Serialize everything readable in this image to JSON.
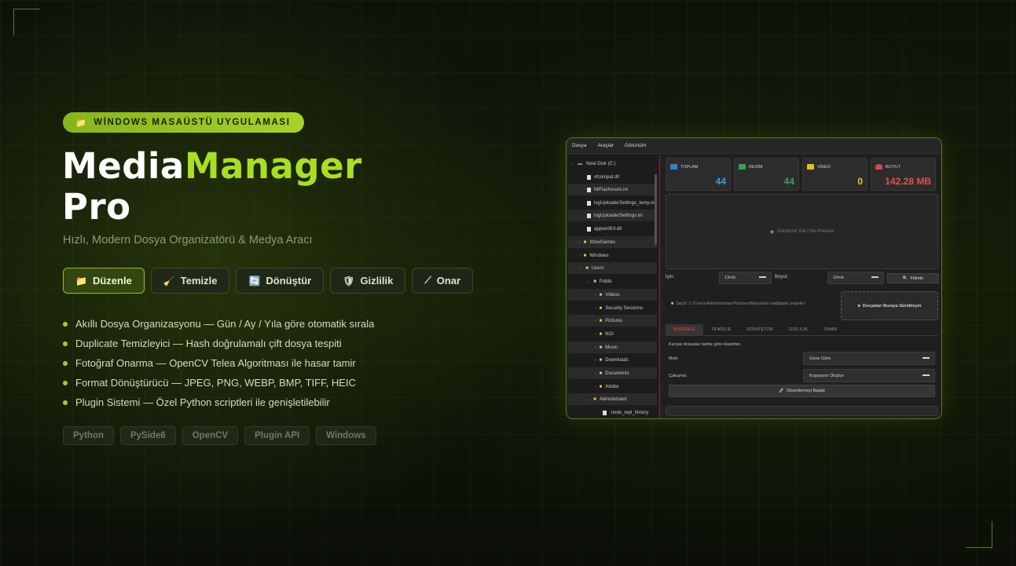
{
  "badge": {
    "icon": "📁",
    "label": "WİNDOWS MASAÜSTÜ UYGULAMASI"
  },
  "hero": {
    "title_part1": "Media",
    "title_part2": "Manager",
    "title_part3": "Pro",
    "subtitle": "Hızlı, Modern Dosya Organizatörü & Medya Aracı"
  },
  "tabs": [
    {
      "icon": "📁",
      "label": "Düzenle",
      "active": true
    },
    {
      "icon": "🧹",
      "label": "Temizle"
    },
    {
      "icon": "🔄",
      "label": "Dönüştür"
    },
    {
      "icon": "🛡",
      "label": "Gizlilik"
    },
    {
      "icon": "⟋",
      "label": "Onar"
    }
  ],
  "features": [
    "Akıllı Dosya Organizasyonu — Gün / Ay / Yıla göre otomatik sırala",
    "Duplicate Temizleyici — Hash doğrulamalı çift dosya tespiti",
    "Fotoğraf Onarma — OpenCV Telea Algoritması ile hasar tamir",
    "Format Dönüştürücü — JPEG, PNG, WEBP, BMP, TIFF, HEIC",
    "Plugin Sistemi — Özel Python scriptleri ile genişletilebilir"
  ],
  "tech": [
    "Python",
    "PySide6",
    "OpenCV",
    "Plugin API",
    "Windows"
  ],
  "app": {
    "menu": [
      "Dosya",
      "Araçlar",
      "Görünüm"
    ],
    "tree": [
      {
        "label": "Yerel Disk (C:)",
        "type": "drive"
      },
      {
        "label": "vfcompat.dll",
        "type": "file"
      },
      {
        "label": "MiFlashvcom.ini",
        "type": "file"
      },
      {
        "label": "logUploaderSettings_temp.ini",
        "type": "file"
      },
      {
        "label": "logUploaderSettings.ini",
        "type": "file"
      },
      {
        "label": "appverifUI.dll",
        "type": "file"
      },
      {
        "label": "XboxGames",
        "type": "folder"
      },
      {
        "label": "Windows",
        "type": "folder"
      },
      {
        "label": "Users",
        "type": "folder"
      },
      {
        "label": "Public",
        "type": "folder"
      },
      {
        "label": "Videos",
        "type": "folder"
      },
      {
        "label": "Security Sessions",
        "type": "folder"
      },
      {
        "label": "Pictures",
        "type": "folder"
      },
      {
        "label": "NGI",
        "type": "folder"
      },
      {
        "label": "Music",
        "type": "folder"
      },
      {
        "label": "Downloads",
        "type": "folder"
      },
      {
        "label": "Documents",
        "type": "folder"
      },
      {
        "label": "Adobe",
        "type": "folder"
      },
      {
        "label": "Administrator",
        "type": "folder"
      },
      {
        "label": ".node_repl_history",
        "type": "file"
      }
    ],
    "stats": [
      {
        "label": "TOPLAM",
        "value": "44",
        "icon_color": "#2f86c8"
      },
      {
        "label": "RESİM",
        "value": "44",
        "icon_color": "#34a05a"
      },
      {
        "label": "VİDEO",
        "value": "0",
        "icon_color": "#e6c01e"
      },
      {
        "label": "BOYUT",
        "value": "142.28 MB",
        "icon_color": "#d94848"
      }
    ],
    "preview_text": "Önizleme Yok / No Preview",
    "filters": {
      "min_label": "İçin:",
      "min_value": "13mb",
      "size_label": "Boyut:",
      "size_value": "10mb",
      "button": "Filtrele"
    },
    "selected_path": "Seçili: C:/Users/Administrator/Pictures/Masaüstü wallpaper projeleri",
    "drop_label": "Dosyaları Buraya Sürükleyin",
    "subtabs": [
      "DÜZENLE",
      "TEMİZLE",
      "DÖNÜŞTÜR",
      "GİZLİLİK",
      "ONAR"
    ],
    "description": "Karışık dosyaları tarihe göre klasörler.",
    "mode_label": "Mod:",
    "mode_value": "Güne Göre",
    "conflict_label": "Çakışma:",
    "conflict_value": "Kopyasını Oluştur",
    "start_button": "Düzenlemeyi Başlat"
  }
}
